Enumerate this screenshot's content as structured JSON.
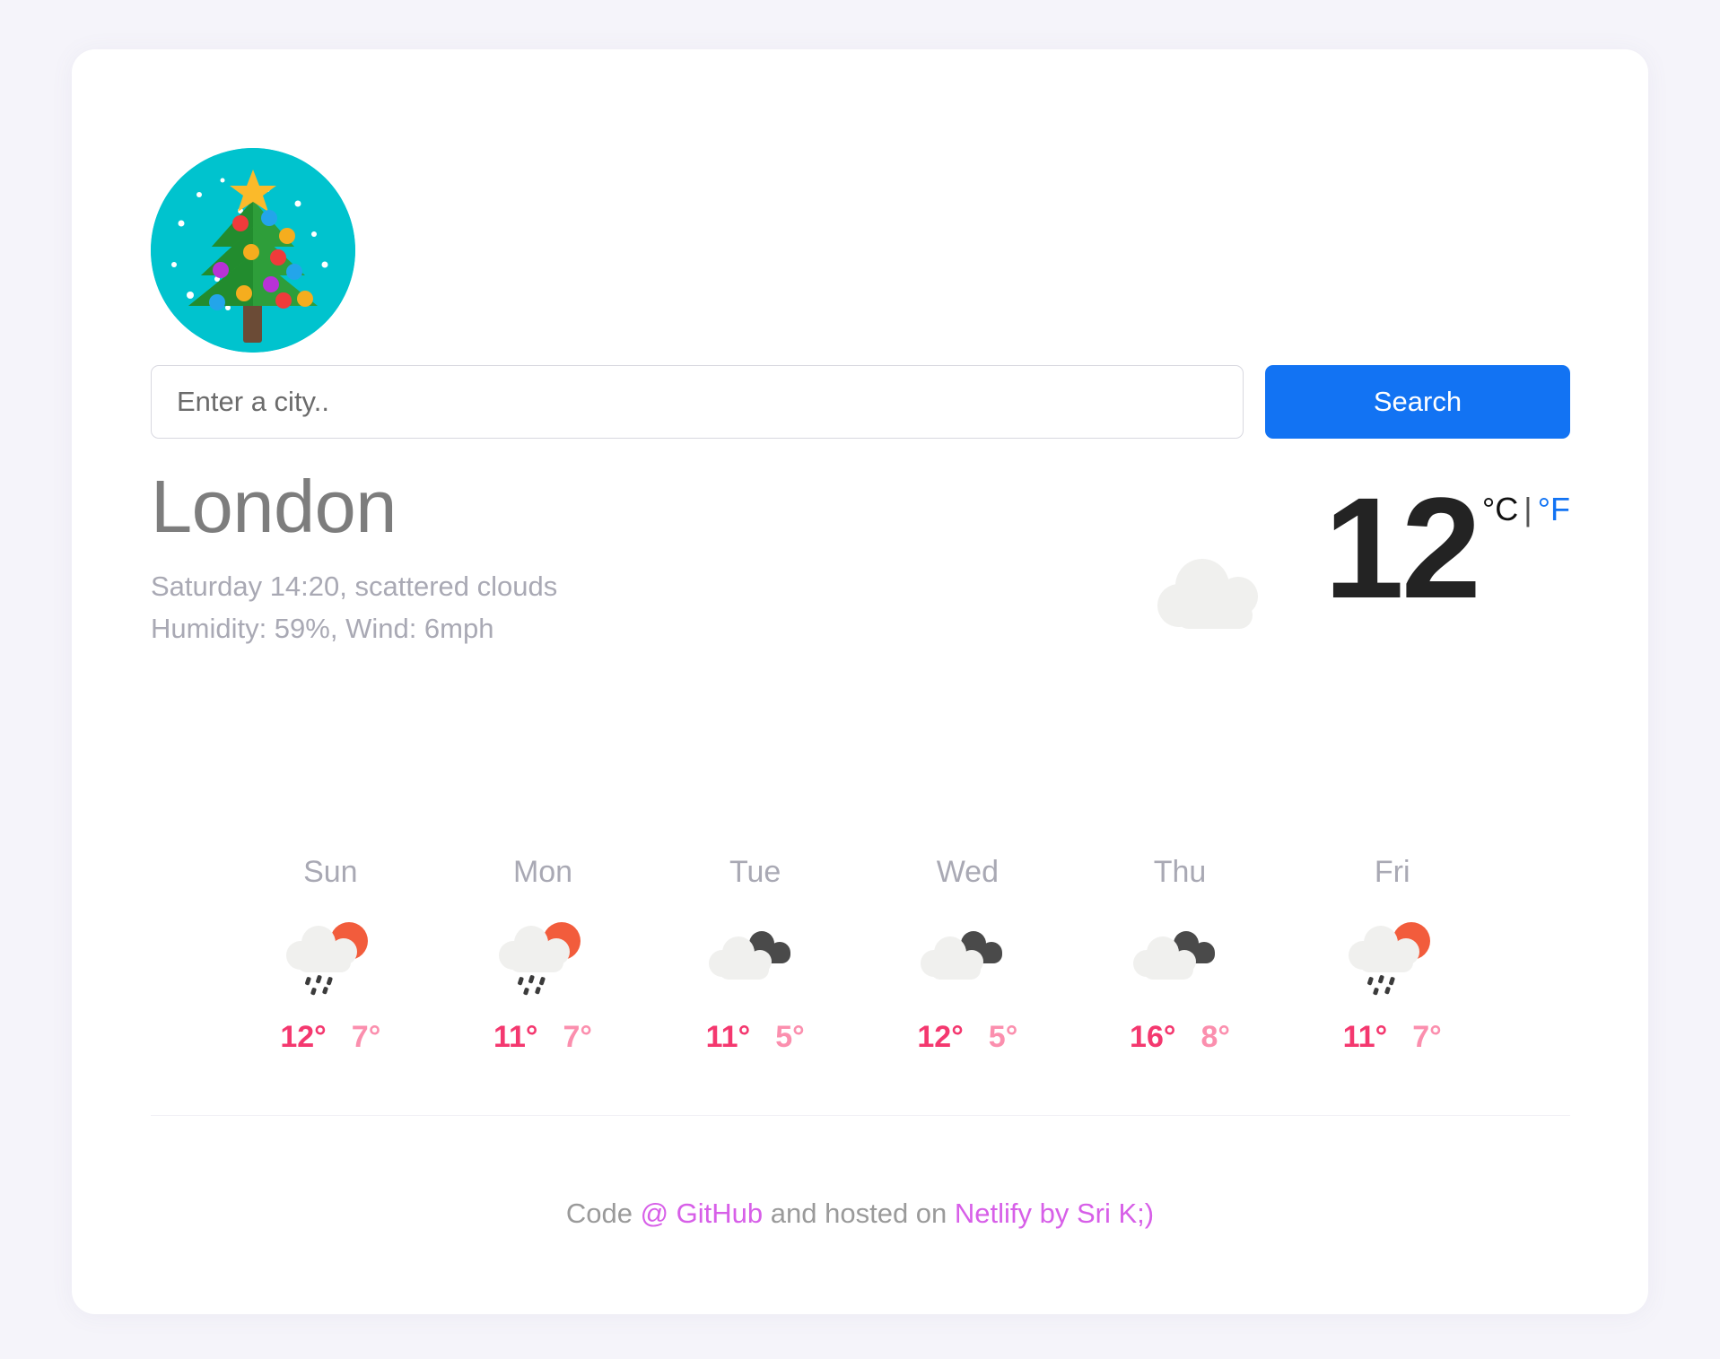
{
  "theme": {
    "page_background": "#f5f4fa",
    "card_background": "#ffffff",
    "accent_blue": "#1273f3",
    "logo_circle": "#00c3ce",
    "temp_high": "#f4386f",
    "temp_low": "#fb8fae",
    "link_magenta": "#d75fe8"
  },
  "logo": {
    "icon": "christmas-tree-icon",
    "circle_color": "#00c3ce"
  },
  "search": {
    "placeholder": "Enter a city..",
    "value": "",
    "button_label": "Search"
  },
  "current": {
    "city": "London",
    "detail_line_1": "Saturday 14:20, scattered clouds",
    "detail_line_2": "Humidity: 59%, Wind: 6mph",
    "condition_icon": "cloud-icon",
    "temperature": "12",
    "unit_celsius": "°C",
    "unit_separator": "|",
    "unit_fahrenheit": "°F",
    "active_unit": "celsius"
  },
  "forecast": [
    {
      "day": "Sun",
      "icon": "sun-rain-cloud-icon",
      "high": "12°",
      "low": "7°"
    },
    {
      "day": "Mon",
      "icon": "sun-rain-cloud-icon",
      "high": "11°",
      "low": "7°"
    },
    {
      "day": "Tue",
      "icon": "broken-clouds-icon",
      "high": "11°",
      "low": "5°"
    },
    {
      "day": "Wed",
      "icon": "broken-clouds-icon",
      "high": "12°",
      "low": "5°"
    },
    {
      "day": "Thu",
      "icon": "broken-clouds-icon",
      "high": "16°",
      "low": "8°"
    },
    {
      "day": "Fri",
      "icon": "sun-rain-cloud-icon",
      "high": "11°",
      "low": "7°"
    }
  ],
  "footer": {
    "text_1": "Code ",
    "link_github": "@ GitHub",
    "text_2": " and hosted on ",
    "link_netlify": "Netlify by Sri K;)"
  }
}
